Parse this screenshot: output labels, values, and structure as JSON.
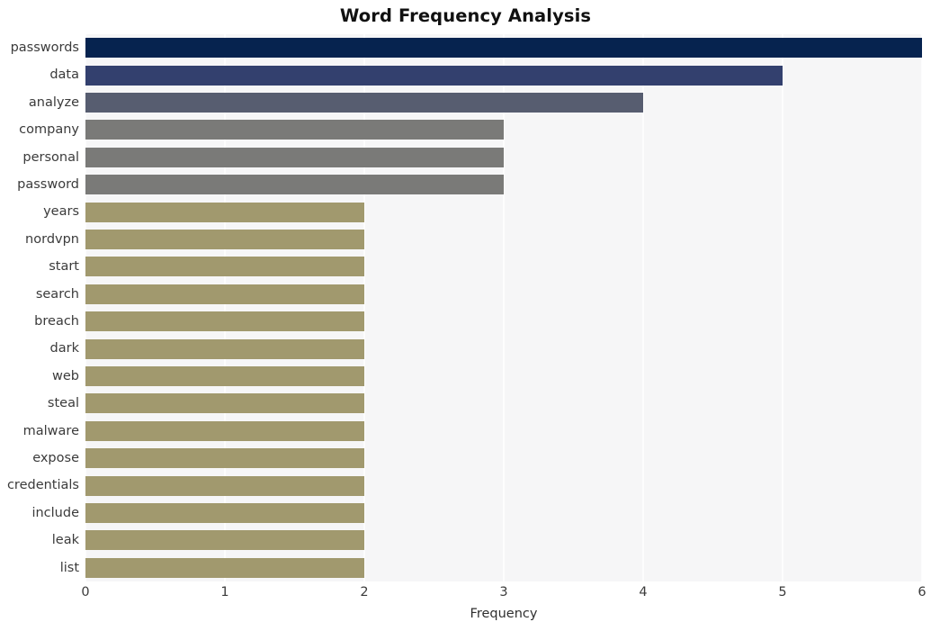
{
  "chart_data": {
    "type": "bar",
    "orientation": "horizontal",
    "title": "Word Frequency Analysis",
    "xlabel": "Frequency",
    "ylabel": "",
    "xlim": [
      0,
      6
    ],
    "xticks": [
      0,
      1,
      2,
      3,
      4,
      5,
      6
    ],
    "xtick_labels": [
      "0",
      "1",
      "2",
      "3",
      "4",
      "5",
      "6"
    ],
    "grid": true,
    "grid_axis": "x",
    "legend": false,
    "categories": [
      "passwords",
      "data",
      "analyze",
      "company",
      "personal",
      "password",
      "years",
      "nordvpn",
      "start",
      "search",
      "breach",
      "dark",
      "web",
      "steal",
      "malware",
      "expose",
      "credentials",
      "include",
      "leak",
      "list"
    ],
    "values": [
      6,
      5,
      4,
      3,
      3,
      3,
      2,
      2,
      2,
      2,
      2,
      2,
      2,
      2,
      2,
      2,
      2,
      2,
      2,
      2
    ],
    "bar_colors": [
      "#06234f",
      "#33406e",
      "#575d70",
      "#7a7a78",
      "#7a7a78",
      "#7a7a78",
      "#a1996e",
      "#a1996e",
      "#a1996e",
      "#a1996e",
      "#a1996e",
      "#a1996e",
      "#a1996e",
      "#a1996e",
      "#a1996e",
      "#a1996e",
      "#a1996e",
      "#a1996e",
      "#a1996e",
      "#a1996e"
    ],
    "plot_background": "#f6f6f7",
    "gridline_color": "#fdfdfd",
    "figure_background": "#ffffff"
  }
}
